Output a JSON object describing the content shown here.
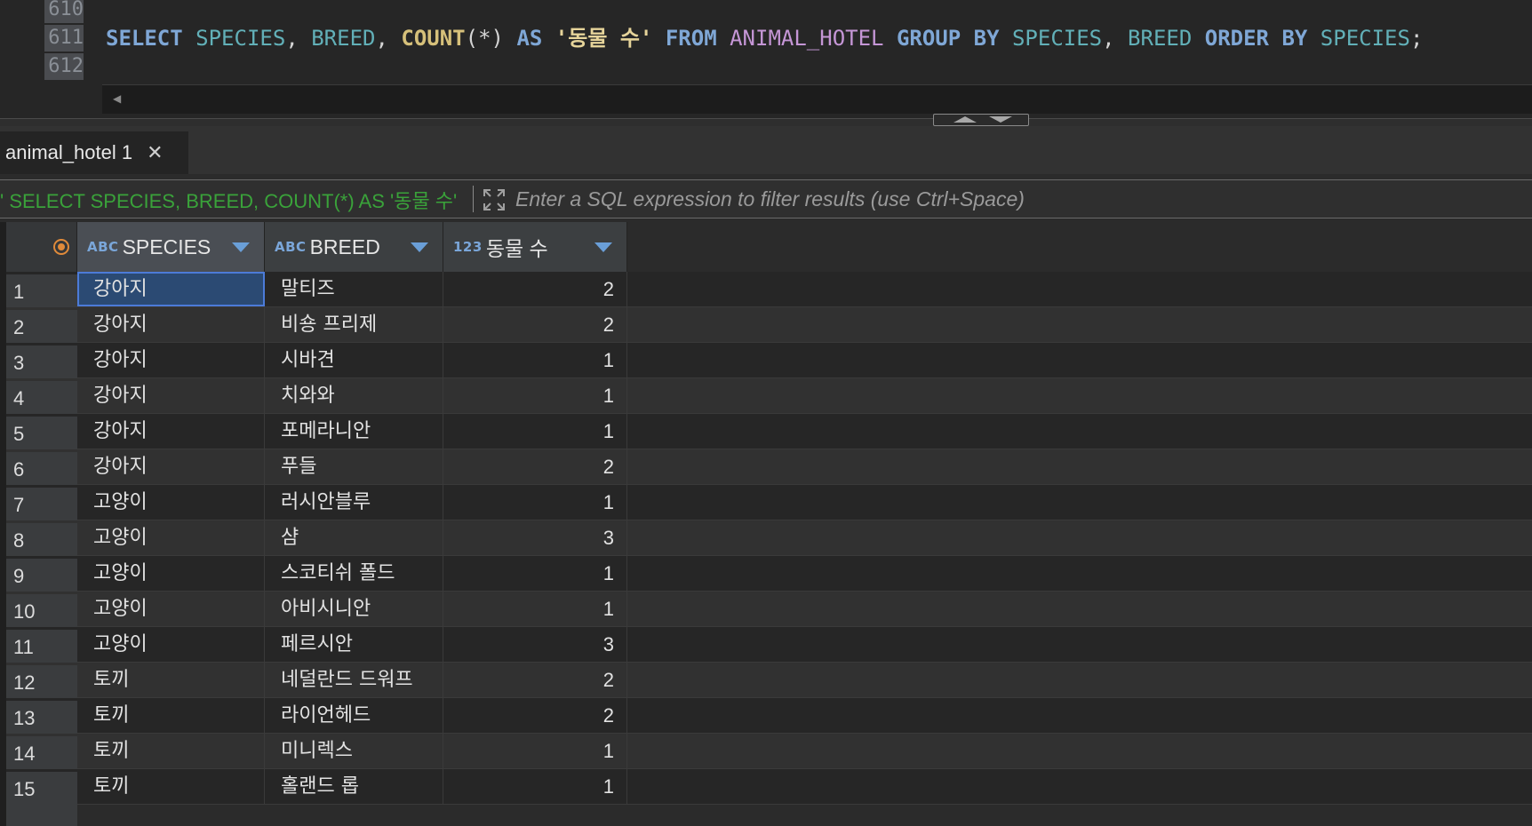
{
  "editor": {
    "line_numbers": [
      "610",
      "611",
      "612"
    ],
    "code": {
      "kw_select": "SELECT",
      "col_species": "SPECIES",
      "comma1": ",",
      "col_breed": "BREED",
      "comma2": ",",
      "fn_count": "COUNT",
      "paren": "(*)",
      "kw_as": "AS",
      "alias": "'동물 수'",
      "kw_from": "FROM",
      "table": "ANIMAL_HOTEL",
      "kw_group_by": "GROUP BY",
      "g_species": "SPECIES",
      "comma3": ",",
      "g_breed": "BREED",
      "kw_order_by": "ORDER BY",
      "o_species": "SPECIES",
      "semicolon": ";"
    }
  },
  "results_tab": {
    "label": "animal_hotel 1"
  },
  "filter": {
    "query_text": "' SELECT SPECIES, BREED, COUNT(*) AS '동물 수'",
    "placeholder": "Enter a SQL expression to filter results (use Ctrl+Space)"
  },
  "grid": {
    "columns": [
      {
        "type": "ABC",
        "label": "SPECIES"
      },
      {
        "type": "ABC",
        "label": "BREED"
      },
      {
        "type": "123",
        "label": "동물 수"
      }
    ],
    "rows": [
      {
        "n": "1",
        "species": "강아지",
        "breed": "말티즈",
        "count": "2"
      },
      {
        "n": "2",
        "species": "강아지",
        "breed": "비숑 프리제",
        "count": "2"
      },
      {
        "n": "3",
        "species": "강아지",
        "breed": "시바견",
        "count": "1"
      },
      {
        "n": "4",
        "species": "강아지",
        "breed": "치와와",
        "count": "1"
      },
      {
        "n": "5",
        "species": "강아지",
        "breed": "포메라니안",
        "count": "1"
      },
      {
        "n": "6",
        "species": "강아지",
        "breed": "푸들",
        "count": "2"
      },
      {
        "n": "7",
        "species": "고양이",
        "breed": "러시안블루",
        "count": "1"
      },
      {
        "n": "8",
        "species": "고양이",
        "breed": "샴",
        "count": "3"
      },
      {
        "n": "9",
        "species": "고양이",
        "breed": "스코티쉬 폴드",
        "count": "1"
      },
      {
        "n": "10",
        "species": "고양이",
        "breed": "아비시니안",
        "count": "1"
      },
      {
        "n": "11",
        "species": "고양이",
        "breed": "페르시안",
        "count": "3"
      },
      {
        "n": "12",
        "species": "토끼",
        "breed": "네덜란드 드워프",
        "count": "2"
      },
      {
        "n": "13",
        "species": "토끼",
        "breed": "라이언헤드",
        "count": "2"
      },
      {
        "n": "14",
        "species": "토끼",
        "breed": "미니렉스",
        "count": "1"
      },
      {
        "n": "15",
        "species": "토끼",
        "breed": "홀랜드 롭",
        "count": "1"
      }
    ]
  },
  "colors": {
    "keyword": "#7fa7d6",
    "identifier": "#62b0b8",
    "function": "#d6c07a",
    "table_name": "#c596d6",
    "filter_text": "#3aa23a",
    "selection": "#4c7bd8"
  }
}
